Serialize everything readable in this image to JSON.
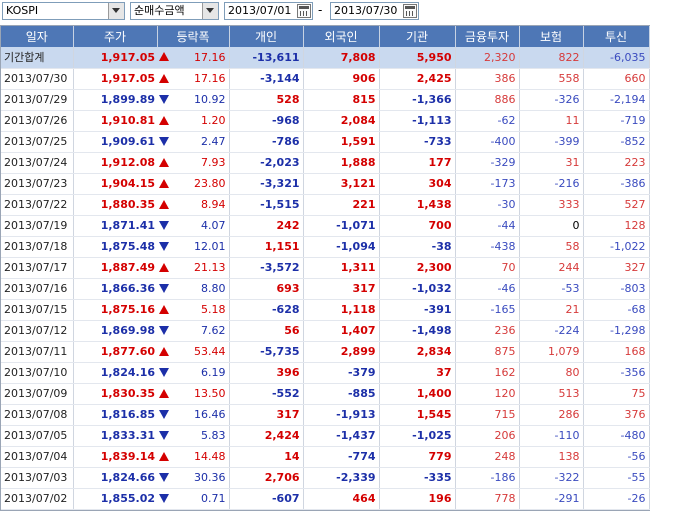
{
  "toolbar": {
    "market": "KOSPI",
    "metric": "순매수금액",
    "date_from": "2013/07/01",
    "separator": "-",
    "date_to": "2013/07/30"
  },
  "columns": [
    "일자",
    "주가",
    "등락폭",
    "개인",
    "외국인",
    "기관",
    "금융투자",
    "보험",
    "투신"
  ],
  "rows": [
    {
      "date": "기간합계",
      "price": "1,917.05",
      "dir": "up",
      "chg": "17.16",
      "ind": "-13,611",
      "frn": "7,808",
      "inst": "5,950",
      "fin": "2,320",
      "ins": "822",
      "trust": "-6,035",
      "sum": true
    },
    {
      "date": "2013/07/30",
      "price": "1,917.05",
      "dir": "up",
      "chg": "17.16",
      "ind": "-3,144",
      "frn": "906",
      "inst": "2,425",
      "fin": "386",
      "ins": "558",
      "trust": "660"
    },
    {
      "date": "2013/07/29",
      "price": "1,899.89",
      "dir": "dn",
      "chg": "10.92",
      "ind": "528",
      "frn": "815",
      "inst": "-1,366",
      "fin": "886",
      "ins": "-326",
      "trust": "-2,194"
    },
    {
      "date": "2013/07/26",
      "price": "1,910.81",
      "dir": "up",
      "chg": "1.20",
      "ind": "-968",
      "frn": "2,084",
      "inst": "-1,113",
      "fin": "-62",
      "ins": "11",
      "trust": "-719"
    },
    {
      "date": "2013/07/25",
      "price": "1,909.61",
      "dir": "dn",
      "chg": "2.47",
      "ind": "-786",
      "frn": "1,591",
      "inst": "-733",
      "fin": "-400",
      "ins": "-399",
      "trust": "-852"
    },
    {
      "date": "2013/07/24",
      "price": "1,912.08",
      "dir": "up",
      "chg": "7.93",
      "ind": "-2,023",
      "frn": "1,888",
      "inst": "177",
      "fin": "-329",
      "ins": "31",
      "trust": "223"
    },
    {
      "date": "2013/07/23",
      "price": "1,904.15",
      "dir": "up",
      "chg": "23.80",
      "ind": "-3,321",
      "frn": "3,121",
      "inst": "304",
      "fin": "-173",
      "ins": "-216",
      "trust": "-386"
    },
    {
      "date": "2013/07/22",
      "price": "1,880.35",
      "dir": "up",
      "chg": "8.94",
      "ind": "-1,515",
      "frn": "221",
      "inst": "1,438",
      "fin": "-30",
      "ins": "333",
      "trust": "527"
    },
    {
      "date": "2013/07/19",
      "price": "1,871.41",
      "dir": "dn",
      "chg": "4.07",
      "ind": "242",
      "frn": "-1,071",
      "inst": "700",
      "fin": "-44",
      "ins": "0",
      "trust": "128"
    },
    {
      "date": "2013/07/18",
      "price": "1,875.48",
      "dir": "dn",
      "chg": "12.01",
      "ind": "1,151",
      "frn": "-1,094",
      "inst": "-38",
      "fin": "-438",
      "ins": "58",
      "trust": "-1,022"
    },
    {
      "date": "2013/07/17",
      "price": "1,887.49",
      "dir": "up",
      "chg": "21.13",
      "ind": "-3,572",
      "frn": "1,311",
      "inst": "2,300",
      "fin": "70",
      "ins": "244",
      "trust": "327"
    },
    {
      "date": "2013/07/16",
      "price": "1,866.36",
      "dir": "dn",
      "chg": "8.80",
      "ind": "693",
      "frn": "317",
      "inst": "-1,032",
      "fin": "-46",
      "ins": "-53",
      "trust": "-803"
    },
    {
      "date": "2013/07/15",
      "price": "1,875.16",
      "dir": "up",
      "chg": "5.18",
      "ind": "-628",
      "frn": "1,118",
      "inst": "-391",
      "fin": "-165",
      "ins": "21",
      "trust": "-68"
    },
    {
      "date": "2013/07/12",
      "price": "1,869.98",
      "dir": "dn",
      "chg": "7.62",
      "ind": "56",
      "frn": "1,407",
      "inst": "-1,498",
      "fin": "236",
      "ins": "-224",
      "trust": "-1,298"
    },
    {
      "date": "2013/07/11",
      "price": "1,877.60",
      "dir": "up",
      "chg": "53.44",
      "ind": "-5,735",
      "frn": "2,899",
      "inst": "2,834",
      "fin": "875",
      "ins": "1,079",
      "trust": "168"
    },
    {
      "date": "2013/07/10",
      "price": "1,824.16",
      "dir": "dn",
      "chg": "6.19",
      "ind": "396",
      "frn": "-379",
      "inst": "37",
      "fin": "162",
      "ins": "80",
      "trust": "-356"
    },
    {
      "date": "2013/07/09",
      "price": "1,830.35",
      "dir": "up",
      "chg": "13.50",
      "ind": "-552",
      "frn": "-885",
      "inst": "1,400",
      "fin": "120",
      "ins": "513",
      "trust": "75"
    },
    {
      "date": "2013/07/08",
      "price": "1,816.85",
      "dir": "dn",
      "chg": "16.46",
      "ind": "317",
      "frn": "-1,913",
      "inst": "1,545",
      "fin": "715",
      "ins": "286",
      "trust": "376"
    },
    {
      "date": "2013/07/05",
      "price": "1,833.31",
      "dir": "dn",
      "chg": "5.83",
      "ind": "2,424",
      "frn": "-1,437",
      "inst": "-1,025",
      "fin": "206",
      "ins": "-110",
      "trust": "-480"
    },
    {
      "date": "2013/07/04",
      "price": "1,839.14",
      "dir": "up",
      "chg": "14.48",
      "ind": "14",
      "frn": "-774",
      "inst": "779",
      "fin": "248",
      "ins": "138",
      "trust": "-56"
    },
    {
      "date": "2013/07/03",
      "price": "1,824.66",
      "dir": "dn",
      "chg": "30.36",
      "ind": "2,706",
      "frn": "-2,339",
      "inst": "-335",
      "fin": "-186",
      "ins": "-322",
      "trust": "-55"
    },
    {
      "date": "2013/07/02",
      "price": "1,855.02",
      "dir": "dn",
      "chg": "0.71",
      "ind": "-607",
      "frn": "464",
      "inst": "196",
      "fin": "778",
      "ins": "-291",
      "trust": "-26"
    }
  ],
  "colors": {
    "header_bg": "#4e77b6",
    "up": "#d40000",
    "down": "#1c2fa8",
    "sum_bg": "#c9d9ef"
  }
}
